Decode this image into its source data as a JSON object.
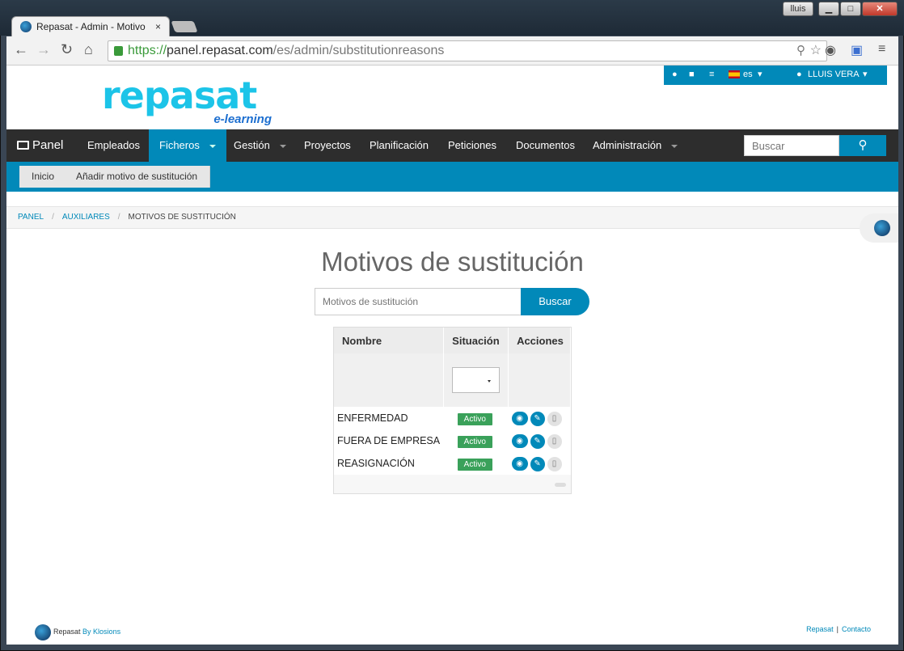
{
  "browser": {
    "tab_title": "Repasat - Admin - Motivo",
    "tab_close": "×",
    "user_chip": "lluis",
    "window_buttons": [
      "▁",
      "□",
      "✕"
    ],
    "url_scheme": "https://",
    "url_host": "panel.repasat.com",
    "url_path": "/es/admin/substitutionreasons",
    "nav_icons": [
      "back-icon",
      "forward-icon",
      "reload-icon",
      "home-icon"
    ]
  },
  "topbar": {
    "language": "es",
    "user_name": "LLUIS VERA"
  },
  "logo": {
    "word": "repasat",
    "sub": "e-learning"
  },
  "mainnav": {
    "panel": "Panel",
    "items": [
      {
        "label": "Empleados",
        "dropdown": false,
        "active": false
      },
      {
        "label": "Ficheros",
        "dropdown": true,
        "active": true
      },
      {
        "label": "Gestión",
        "dropdown": true,
        "active": false
      },
      {
        "label": "Proyectos",
        "dropdown": false,
        "active": false
      },
      {
        "label": "Planificación",
        "dropdown": false,
        "active": false
      },
      {
        "label": "Peticiones",
        "dropdown": false,
        "active": false
      },
      {
        "label": "Documentos",
        "dropdown": false,
        "active": false
      },
      {
        "label": "Administración",
        "dropdown": true,
        "active": false
      }
    ],
    "search_placeholder": "Buscar"
  },
  "subnav": {
    "items": [
      "Inicio",
      "Añadir motivo de sustitución"
    ]
  },
  "breadcrumb": {
    "items": [
      "PANEL",
      "AUXILIARES",
      "MOTIVOS DE SUSTITUCIÓN"
    ]
  },
  "main": {
    "title": "Motivos de sustitución",
    "search_placeholder": "Motivos de sustitución",
    "search_button": "Buscar",
    "table": {
      "headers": [
        "Nombre",
        "Situación",
        "Acciones"
      ],
      "rows": [
        {
          "name": "ENFERMEDAD",
          "status": "Activo"
        },
        {
          "name": "FUERA DE EMPRESA",
          "status": "Activo"
        },
        {
          "name": "REASIGNACIÓN",
          "status": "Activo"
        }
      ]
    }
  },
  "footer": {
    "brand": "Repasat",
    "by": "By Klosions",
    "links": [
      "Repasat",
      "Contacto"
    ]
  },
  "colors": {
    "accent": "#0189b9",
    "nav_bg": "#2d2d2d",
    "badge": "#3aa15a"
  }
}
